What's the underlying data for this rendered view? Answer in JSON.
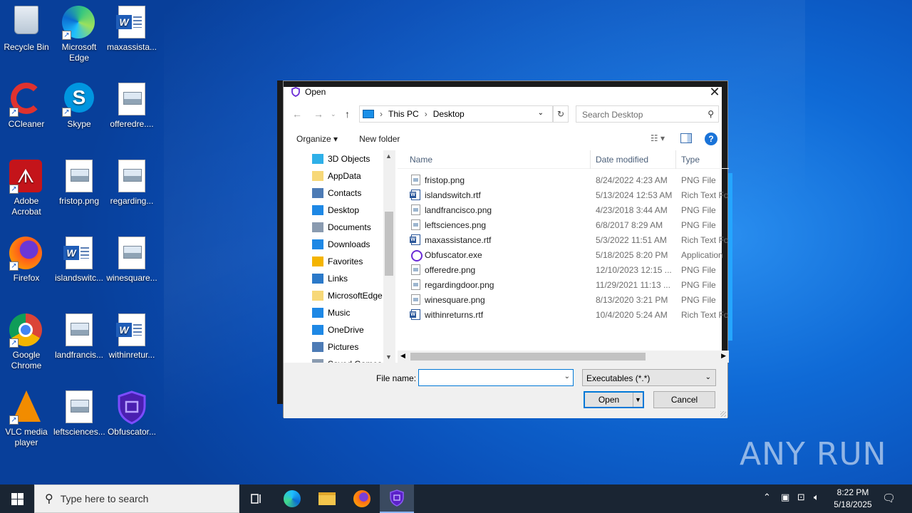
{
  "desktop": {
    "icons": [
      {
        "label": "Recycle Bin"
      },
      {
        "label": "Microsoft Edge"
      },
      {
        "label": "maxassista..."
      },
      {
        "label": "CCleaner"
      },
      {
        "label": "Skype"
      },
      {
        "label": "offeredre...."
      },
      {
        "label": "Adobe Acrobat"
      },
      {
        "label": "fristop.png"
      },
      {
        "label": "regarding..."
      },
      {
        "label": "Firefox"
      },
      {
        "label": "islandswitc..."
      },
      {
        "label": "winesquare..."
      },
      {
        "label": "Google Chrome"
      },
      {
        "label": "landfrancis..."
      },
      {
        "label": "withinretur..."
      },
      {
        "label": "VLC media player"
      },
      {
        "label": "leftsciences..."
      },
      {
        "label": "Obfuscator..."
      }
    ]
  },
  "dialog": {
    "title": "Open",
    "breadcrumb": [
      "This PC",
      "Desktop"
    ],
    "search_placeholder": "Search Desktop",
    "organize": "Organize",
    "new_folder": "New folder",
    "nav_items": [
      "3D Objects",
      "AppData",
      "Contacts",
      "Desktop",
      "Documents",
      "Downloads",
      "Favorites",
      "Links",
      "MicrosoftEdge",
      "Music",
      "OneDrive",
      "Pictures",
      "Saved Games"
    ],
    "columns": {
      "name": "Name",
      "date": "Date modified",
      "type": "Type"
    },
    "files": [
      {
        "name": "fristop.png",
        "date": "8/24/2022 4:23 AM",
        "type": "PNG File",
        "kind": "img"
      },
      {
        "name": "islandswitch.rtf",
        "date": "5/13/2024 12:53 AM",
        "type": "Rich Text For",
        "kind": "rtf"
      },
      {
        "name": "landfrancisco.png",
        "date": "4/23/2018 3:44 AM",
        "type": "PNG File",
        "kind": "img"
      },
      {
        "name": "leftsciences.png",
        "date": "6/8/2017 8:29 AM",
        "type": "PNG File",
        "kind": "img"
      },
      {
        "name": "maxassistance.rtf",
        "date": "5/3/2022 11:51 AM",
        "type": "Rich Text For",
        "kind": "rtf"
      },
      {
        "name": "Obfuscator.exe",
        "date": "5/18/2025 8:20 PM",
        "type": "Application",
        "kind": "exe"
      },
      {
        "name": "offeredre.png",
        "date": "12/10/2023 12:15 ...",
        "type": "PNG File",
        "kind": "img"
      },
      {
        "name": "regardingdoor.png",
        "date": "11/29/2021 11:13 ...",
        "type": "PNG File",
        "kind": "img"
      },
      {
        "name": "winesquare.png",
        "date": "8/13/2020 3:21 PM",
        "type": "PNG File",
        "kind": "img"
      },
      {
        "name": "withinreturns.rtf",
        "date": "10/4/2020 5:24 AM",
        "type": "Rich Text For",
        "kind": "rtf"
      }
    ],
    "file_name_label": "File name:",
    "file_name_value": "",
    "filter": "Executables (*.*)",
    "open_button": "Open",
    "cancel_button": "Cancel"
  },
  "taskbar": {
    "search_placeholder": "Type here to search",
    "time": "8:22 PM",
    "date": "5/18/2025"
  },
  "watermark": "ANY RUN"
}
